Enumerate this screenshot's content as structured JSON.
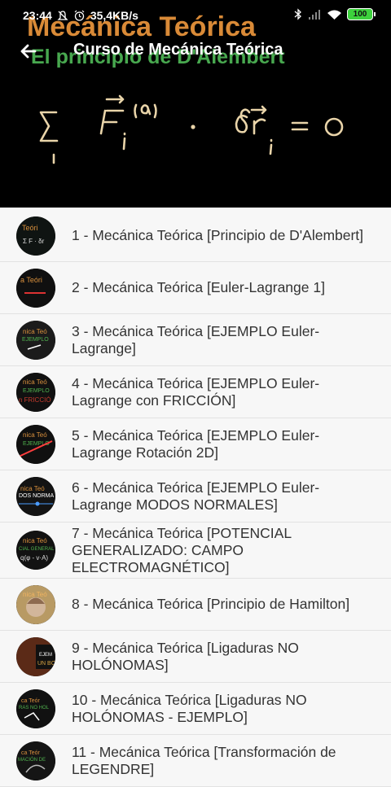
{
  "status_bar": {
    "time": "23:44",
    "speed": "35,4KB/s",
    "battery": "100"
  },
  "header": {
    "title": "Curso de Mecánica Teórica",
    "hero_title": "Mecánica Teórica",
    "hero_subtitle": "El principio de D'Alembert",
    "hero_formula": "Σ F⃗ᵢ⁽ᵃ⁾ · δr⃗ᵢ = 0"
  },
  "videos": [
    {
      "label": "1 - Mecánica Teórica [Principio de D'Alembert]",
      "thumb_color": "#0f1412"
    },
    {
      "label": "2 - Mecánica Teórica [Euler-Lagrange 1]",
      "thumb_color": "#101010"
    },
    {
      "label": "3 - Mecánica Teórica [EJEMPLO Euler-Lagrange]",
      "thumb_color": "#1b1b1b"
    },
    {
      "label": "4 - Mecánica Teórica [EJEMPLO Euler-Lagrange con FRICCIÓN]",
      "thumb_color": "#111"
    },
    {
      "label": "5 - Mecánica Teórica [EJEMPLO Euler-Lagrange Rotación 2D]",
      "thumb_color": "#101010"
    },
    {
      "label": "6 - Mecánica Teórica [EJEMPLO Euler-Lagrange MODOS NORMALES]",
      "thumb_color": "#131313"
    },
    {
      "label": "7 - Mecánica Teórica [POTENCIAL GENERALIZADO: CAMPO ELECTROMAGNÉTICO]",
      "thumb_color": "#121212"
    },
    {
      "label": "8 - Mecánica Teórica [Principio de Hamilton]",
      "thumb_color": "#b89a64"
    },
    {
      "label": "9 - Mecánica Teórica [Ligaduras NO HOLÓNOMAS]",
      "thumb_color": "#5b2a17"
    },
    {
      "label": "10 - Mecánica Teórica [Ligaduras NO HOLÓNOMAS - EJEMPLO]",
      "thumb_color": "#111"
    },
    {
      "label": "11 - Mecánica Teórica [Transformación de LEGENDRE]",
      "thumb_color": "#151515"
    }
  ]
}
